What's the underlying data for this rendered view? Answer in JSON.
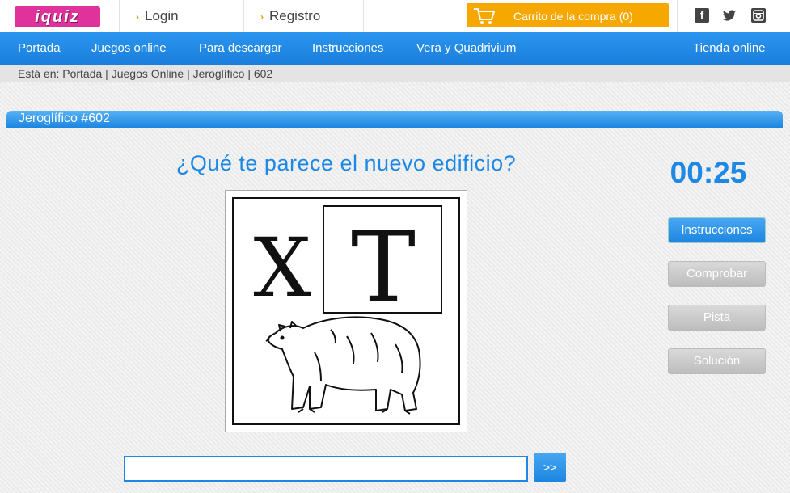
{
  "header": {
    "logo_text": "iquiz",
    "login_label": "Login",
    "registro_label": "Registro",
    "cart_label": "Carrito de la compra (0)",
    "social": {
      "facebook": "f",
      "twitter": "🐦",
      "instagram": "▣"
    }
  },
  "nav": {
    "items": [
      "Portada",
      "Juegos online",
      "Para descargar",
      "Instrucciones",
      "Vera y Quadrivium"
    ],
    "right": "Tienda online"
  },
  "breadcrumb": "Está en: Portada | Juegos Online | Jeroglífico | 602",
  "section_title": "Jeroglífico #602",
  "puzzle": {
    "question": "¿Qué te parece el nuevo edificio?",
    "glyph_x": "X",
    "glyph_t": "T",
    "image": "bear-drawing"
  },
  "timer": "00:25",
  "buttons": {
    "instrucciones": "Instrucciones",
    "comprobar": "Comprobar",
    "pista": "Pista",
    "solucion": "Solución",
    "submit": ">>"
  },
  "answer_value": "",
  "colors": {
    "accent": "#1e88e5",
    "cart": "#f7a800",
    "logo": "#e0329b"
  }
}
